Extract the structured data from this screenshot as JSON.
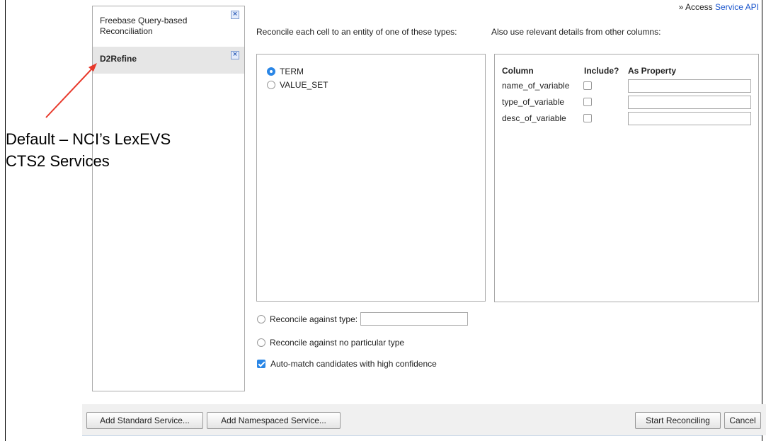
{
  "header": {
    "prefix": "» Access ",
    "link": "Service API"
  },
  "services": [
    {
      "label": "Freebase Query-based Reconciliation",
      "selected": false
    },
    {
      "label": "D2Refine",
      "selected": true
    }
  ],
  "types": {
    "heading": "Reconcile each cell to an entity of one of these types:",
    "options": [
      {
        "label": "TERM",
        "checked": true
      },
      {
        "label": "VALUE_SET",
        "checked": false
      }
    ]
  },
  "options": {
    "against_type": "Reconcile against type:",
    "against_type_value": "",
    "no_type": "Reconcile against no particular type",
    "auto_match": "Auto-match candidates with high confidence"
  },
  "columns": {
    "heading": "Also use relevant details from other columns:",
    "headers": {
      "column": "Column",
      "include": "Include?",
      "property": "As Property"
    },
    "rows": [
      {
        "name": "name_of_variable",
        "include": false,
        "property": ""
      },
      {
        "name": "type_of_variable",
        "include": false,
        "property": ""
      },
      {
        "name": "desc_of_variable",
        "include": false,
        "property": ""
      }
    ]
  },
  "buttons": {
    "add_standard": "Add Standard Service...",
    "add_namespaced": "Add Namespaced Service...",
    "start": "Start Reconciling",
    "cancel": "Cancel"
  },
  "annotation": {
    "line1": "Default – NCI’s LexEVS",
    "line2": "CTS2 Services",
    "color": "#e8392b"
  }
}
